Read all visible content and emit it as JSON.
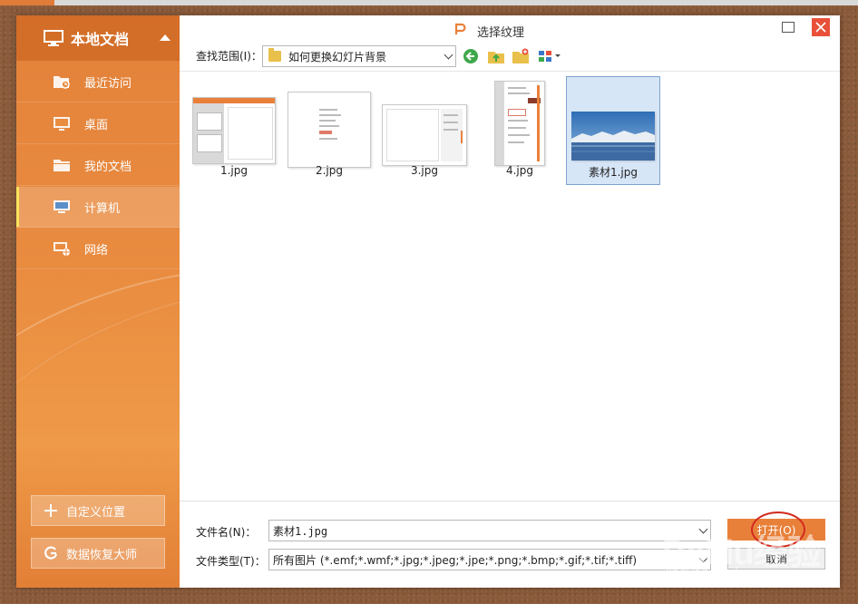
{
  "dialog_title": "选择纹理",
  "sidebar": {
    "header": "本地文档",
    "items": [
      {
        "label": "最近访问",
        "icon": "recent-folder-icon"
      },
      {
        "label": "桌面",
        "icon": "desktop-icon"
      },
      {
        "label": "我的文档",
        "icon": "folder-icon"
      },
      {
        "label": "计算机",
        "icon": "computer-icon",
        "active": true
      },
      {
        "label": "网络",
        "icon": "network-icon"
      }
    ],
    "custom_location": "自定义位置",
    "data_recovery": "数据恢复大师"
  },
  "toolbar": {
    "look_in_label": "查找范围(I)：",
    "look_in_value": "如何更换幻灯片背景"
  },
  "files": [
    {
      "name": "1.jpg"
    },
    {
      "name": "2.jpg"
    },
    {
      "name": "3.jpg"
    },
    {
      "name": "4.jpg"
    },
    {
      "name": "素材1.jpg",
      "selected": true
    }
  ],
  "bottom": {
    "filename_label": "文件名(N)：",
    "filename_value": "素材1.jpg",
    "filetype_label": "文件类型(T)：",
    "filetype_value": "所有图片 (*.emf;*.wmf;*.jpg;*.jpeg;*.jpe;*.png;*.bmp;*.gif;*.tif;*.tiff)",
    "open_label": "打开(O)",
    "cancel_label": "取消"
  },
  "watermark": {
    "brand": "Baidu经验",
    "url": "jingyan.baidu.com"
  },
  "colors": {
    "accent": "#e9803a",
    "sidebar": "#e98c40",
    "close": "#e8503a",
    "selection": "#d7e6f7"
  }
}
